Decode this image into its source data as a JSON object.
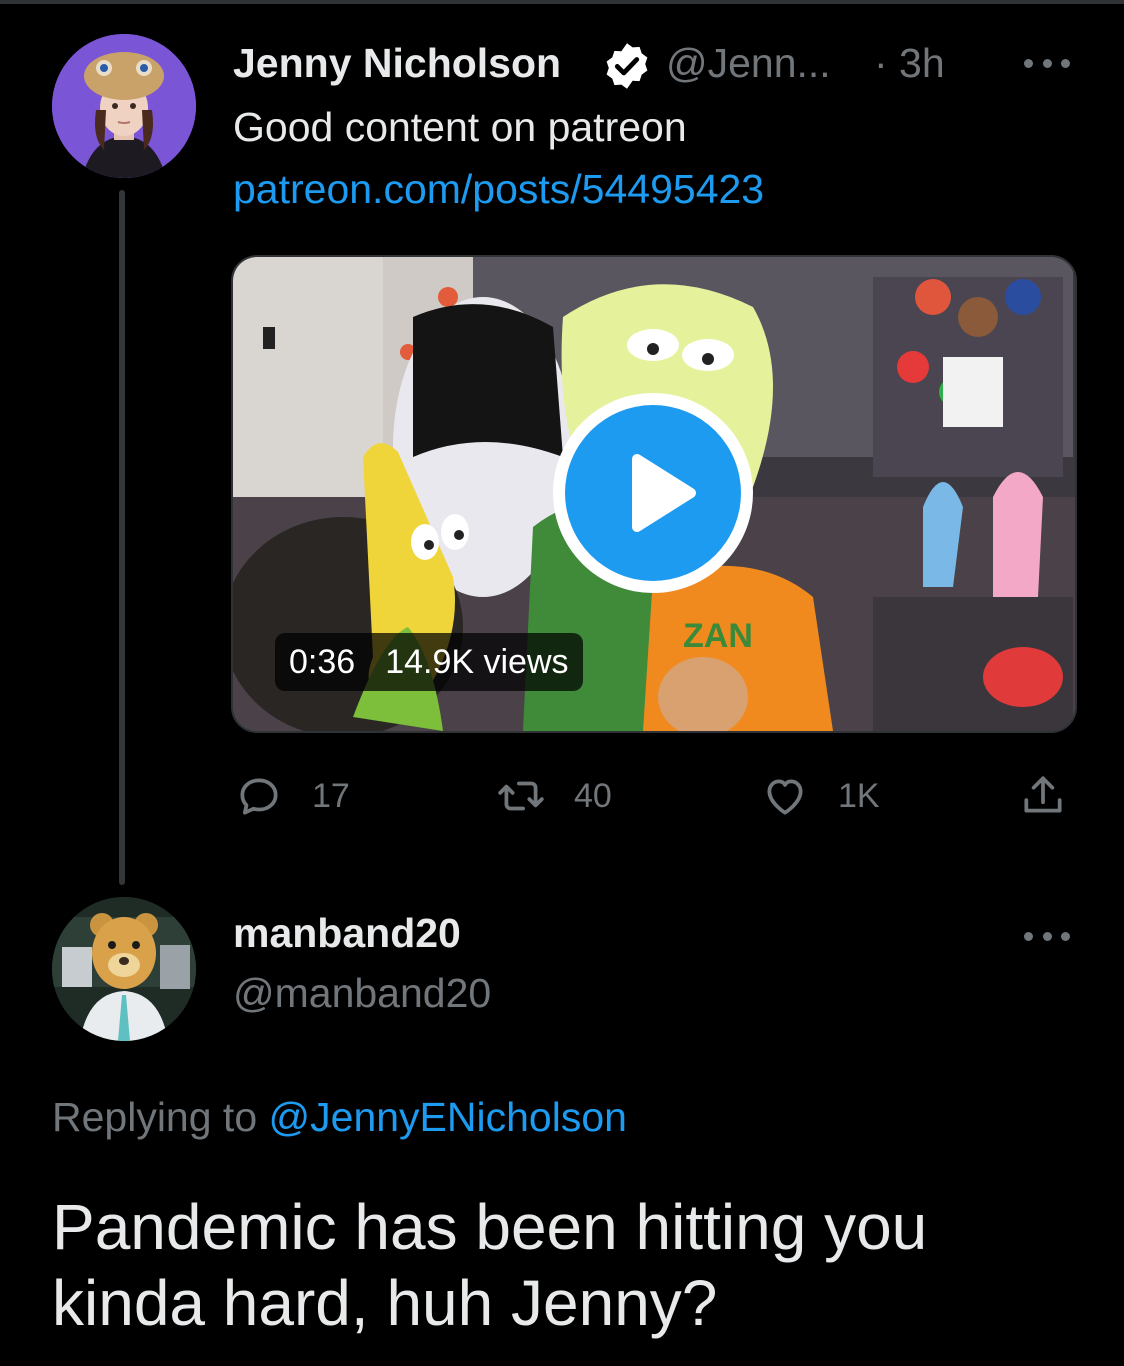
{
  "colors": {
    "background": "#000000",
    "text_primary": "#e7e9ea",
    "text_secondary": "#71767b",
    "link_blue": "#1d9bf0",
    "verified_badge": "#ffffff"
  },
  "tweet": {
    "author_name": "Jenny Nicholson",
    "verified": true,
    "handle": "@Jenn...",
    "time": "· 3h",
    "text": "Good content on patreon",
    "link": "patreon.com/posts/54495423",
    "video": {
      "duration": "0:36",
      "views": "14.9K views",
      "shirt_text": "ZAN"
    },
    "actions": {
      "replies": "17",
      "retweets": "40",
      "likes": "1K"
    },
    "icons": [
      "reply-icon",
      "retweet-icon",
      "like-icon",
      "share-icon",
      "more-icon",
      "verified-icon",
      "play-icon"
    ]
  },
  "reply": {
    "author_name": "manband20",
    "handle": "@manband20",
    "replying_label": "Replying to",
    "replying_to": "@JennyENicholson",
    "text": "Pandemic has been hitting you kinda hard, huh Jenny?"
  }
}
